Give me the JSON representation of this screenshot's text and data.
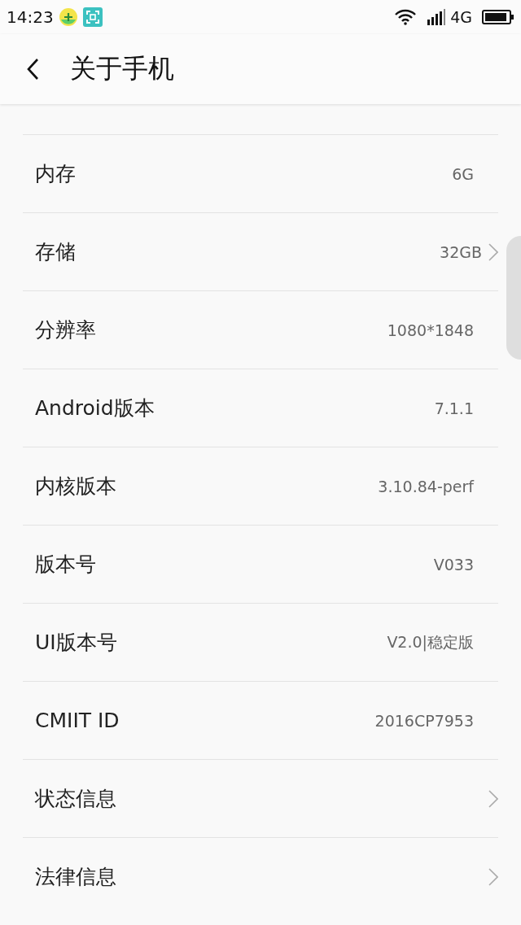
{
  "status_bar": {
    "time": "14:23",
    "network": "4G"
  },
  "header": {
    "title": "关于手机"
  },
  "items": [
    {
      "label": "内存",
      "value": "6G",
      "arrow": false
    },
    {
      "label": "存储",
      "value": "32GB",
      "arrow": true
    },
    {
      "label": "分辨率",
      "value": "1080*1848",
      "arrow": false
    },
    {
      "label": "Android版本",
      "value": "7.1.1",
      "arrow": false
    },
    {
      "label": "内核版本",
      "value": "3.10.84-perf",
      "arrow": false
    },
    {
      "label": "版本号",
      "value": "V033",
      "arrow": false
    },
    {
      "label": "UI版本号",
      "value": "V2.0|稳定版",
      "arrow": false
    },
    {
      "label": "CMIIT ID",
      "value": "2016CP7953",
      "arrow": false
    },
    {
      "label": "状态信息",
      "value": "",
      "arrow": true
    },
    {
      "label": "法律信息",
      "value": "",
      "arrow": true
    }
  ]
}
